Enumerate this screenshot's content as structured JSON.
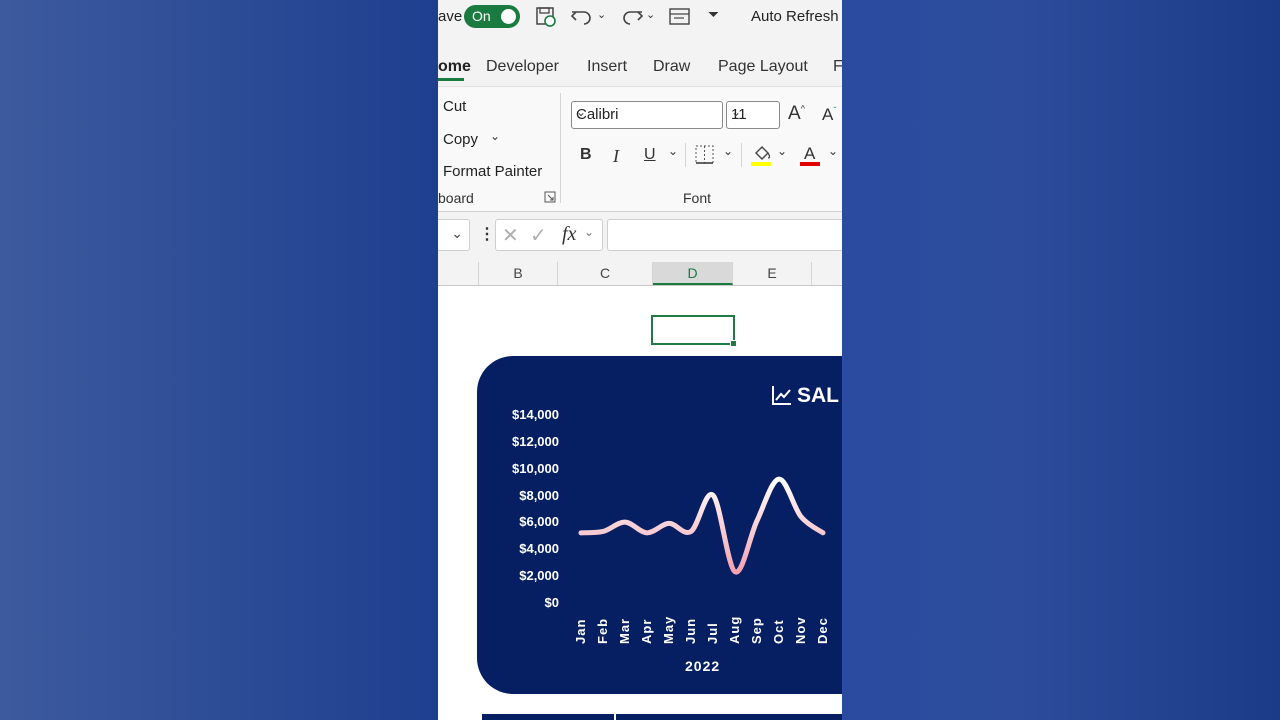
{
  "titlebar": {
    "autosave_partial": "ave",
    "toggle_label": "On",
    "auto_refresh": "Auto Refresh"
  },
  "tabs": [
    {
      "label": "ome",
      "active": true
    },
    {
      "label": "Developer"
    },
    {
      "label": "Insert"
    },
    {
      "label": "Draw"
    },
    {
      "label": "Page Layout"
    },
    {
      "label": "F"
    }
  ],
  "ribbon": {
    "clipboard": {
      "cut": "Cut",
      "copy": "Copy",
      "format_painter": "Format Painter",
      "group_label": "board"
    },
    "font": {
      "font_name": "Calibri",
      "font_size": "11",
      "bold": "B",
      "italic": "I",
      "underline": "U",
      "group_label": "Font"
    }
  },
  "formula_bar": {
    "fx": "fx",
    "value": ""
  },
  "columns": [
    "B",
    "C",
    "D",
    "E"
  ],
  "selected_column": "D",
  "colors": {
    "excel_green": "#1a7b40",
    "chart_bg": "#061f63",
    "line_start": "#f4a3b0",
    "line_end": "#ffffff"
  },
  "chart_data": {
    "type": "line",
    "title": "SAL",
    "xlabel": "2022",
    "ylabel": "",
    "ylim": [
      0,
      14000
    ],
    "yticks": [
      "$14,000",
      "$12,000",
      "$10,000",
      "$8,000",
      "$6,000",
      "$4,000",
      "$2,000",
      "$0"
    ],
    "categories": [
      "Jan",
      "Feb",
      "Mar",
      "Apr",
      "May",
      "Jun",
      "Jul",
      "Aug",
      "Sep",
      "Oct",
      "Nov",
      "Dec"
    ],
    "series": [
      {
        "values": [
          5300,
          5400,
          6100,
          5300,
          6000,
          5400,
          8100,
          2400,
          6200,
          9300,
          6500,
          5300
        ]
      }
    ],
    "grid": false
  }
}
